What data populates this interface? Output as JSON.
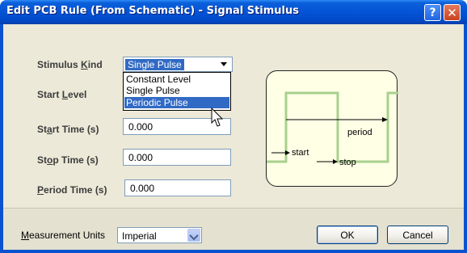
{
  "window": {
    "title": "Edit PCB Rule (From Schematic) - Signal Stimulus",
    "help_glyph": "?",
    "close_glyph": "✕"
  },
  "form": {
    "stimulus_kind": {
      "label_pre": "Stimulus ",
      "label_key": "K",
      "label_post": "ind",
      "value": "Single Pulse",
      "options": [
        "Constant Level",
        "Single Pulse",
        "Periodic Pulse"
      ],
      "highlighted_option": "Periodic Pulse"
    },
    "start_level": {
      "label_pre": "Start ",
      "label_key": "L",
      "label_post": "evel"
    },
    "start_time": {
      "label_pre": "St",
      "label_key": "a",
      "label_post": "rt Time (s)",
      "value": "0.000"
    },
    "stop_time": {
      "label_pre": "St",
      "label_key": "o",
      "label_post": "p Time (s)",
      "value": "0.000"
    },
    "period_time": {
      "label_pre": "",
      "label_key": "P",
      "label_post": "eriod Time (s)",
      "value": "0.000"
    }
  },
  "diagram": {
    "period_label": "period",
    "start_label": "start",
    "stop_label": "stop",
    "waveform_color": "#a8d08d"
  },
  "footer": {
    "units_label_key": "M",
    "units_label_post": "easurement Units",
    "units_value": "Imperial",
    "ok_label": "OK",
    "cancel_label": "Cancel"
  }
}
